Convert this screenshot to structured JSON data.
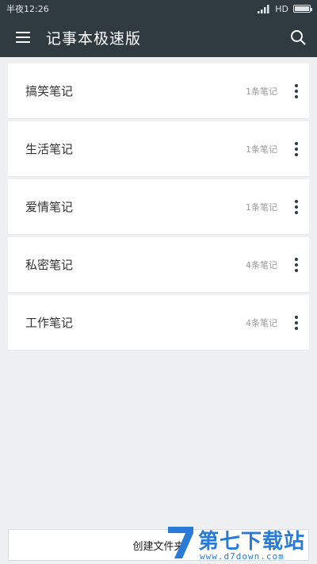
{
  "status_bar": {
    "time": "半夜12:26",
    "network": "HD"
  },
  "app_bar": {
    "title": "记事本极速版",
    "menu_icon": "hamburger-icon",
    "search_icon": "search-icon"
  },
  "notebooks": [
    {
      "label": "搞笑笔记",
      "count": "1条笔记"
    },
    {
      "label": "生活笔记",
      "count": "1条笔记"
    },
    {
      "label": "爱情笔记",
      "count": "1条笔记"
    },
    {
      "label": "私密笔记",
      "count": "4条笔记"
    },
    {
      "label": "工作笔记",
      "count": "4条笔记"
    }
  ],
  "footer": {
    "create_label": "创建文件夹"
  },
  "watermark": {
    "brand": "第七下载站",
    "url": "www.d7down.com"
  },
  "colors": {
    "app_bar": "#2f3b40",
    "background": "#eef0f1",
    "card": "#ffffff",
    "watermark": "#2a7ad8"
  }
}
